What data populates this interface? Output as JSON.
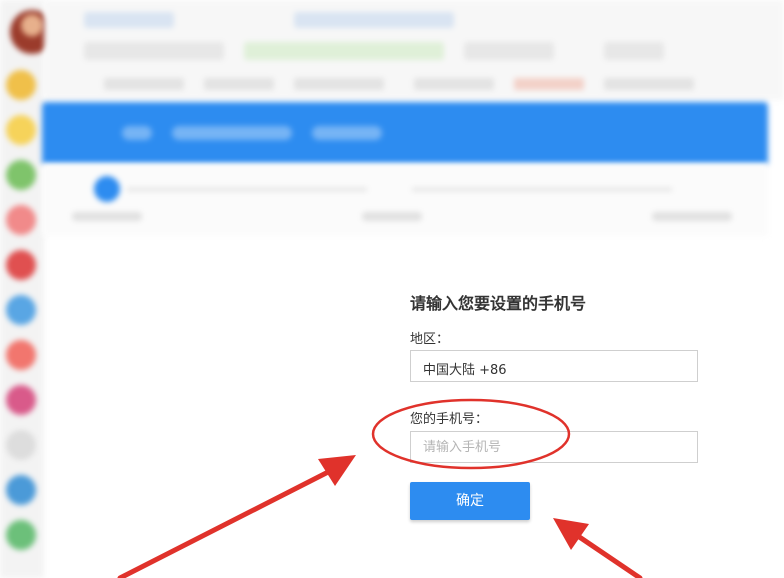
{
  "form": {
    "title": "请输入您要设置的手机号",
    "region_label": "地区：",
    "region_value": "中国大陆 +86",
    "phone_label": "您的手机号：",
    "phone_placeholder": "请输入手机号",
    "confirm_label": "确定"
  },
  "colors": {
    "accent": "#2d8cf0",
    "annotation": "#e0322b"
  },
  "icons": [
    "avatar",
    "app-icon",
    "arrow-annotation",
    "circle-annotation"
  ]
}
